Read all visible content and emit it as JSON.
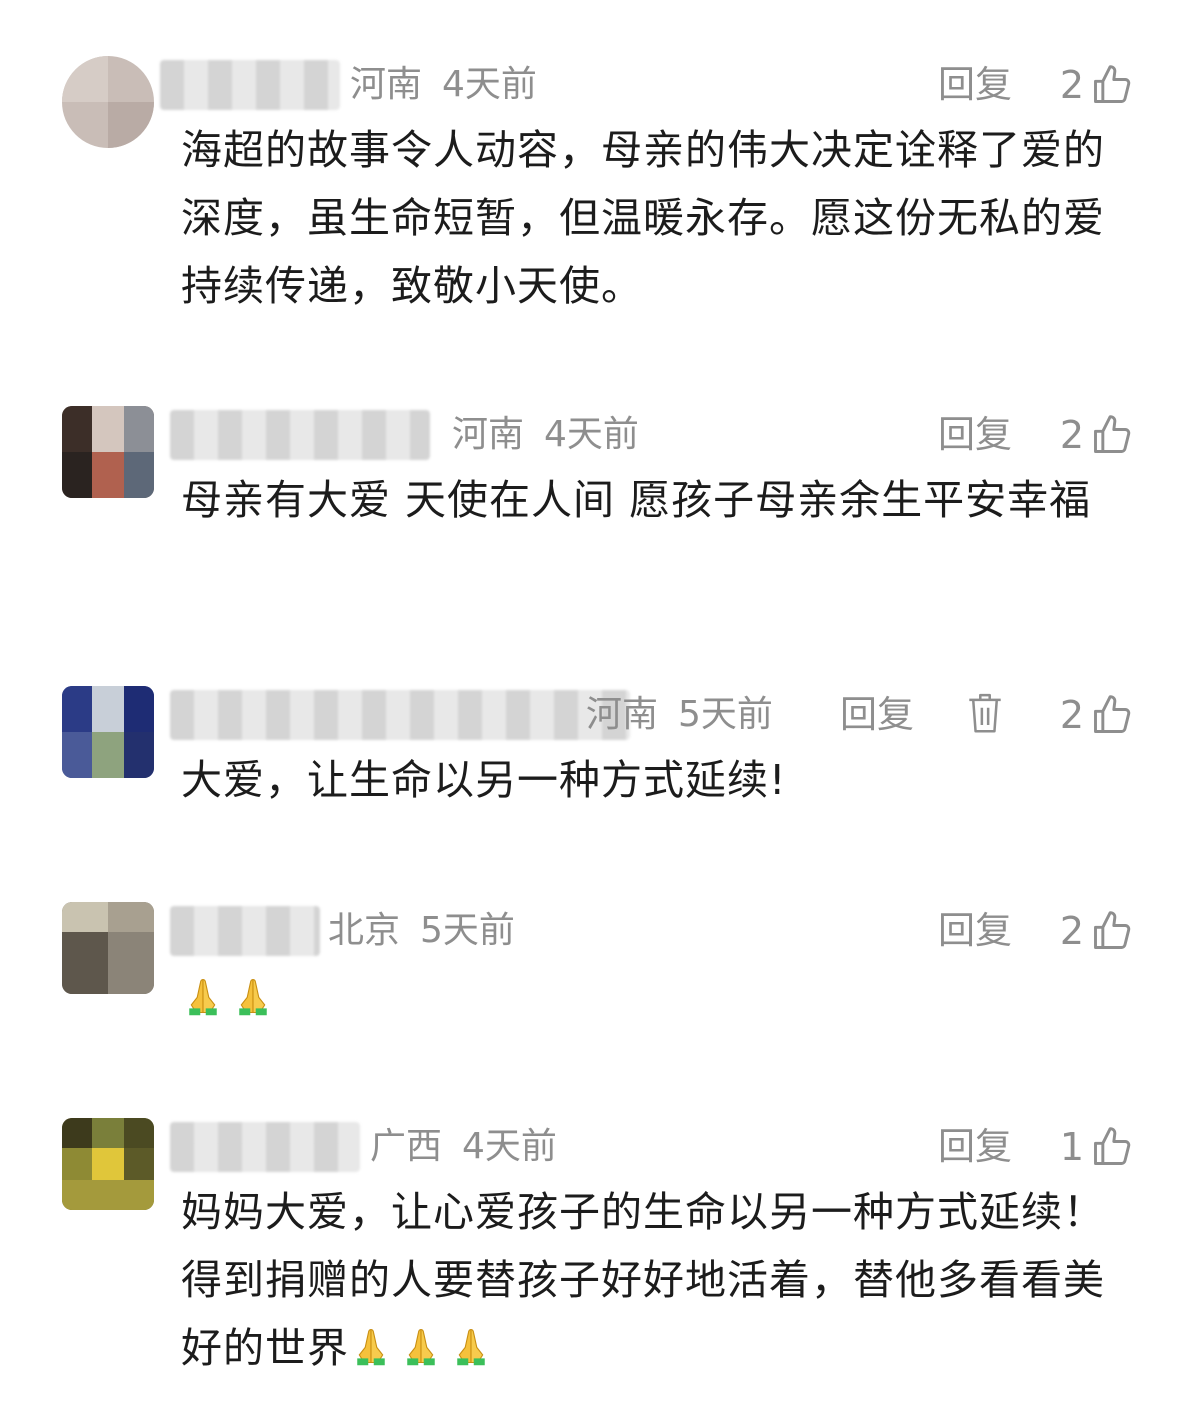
{
  "comments": [
    {
      "location": "河南",
      "time": "4天前",
      "reply_label": "回复",
      "likes": "2",
      "text": "海超的故事令人动容，母亲的伟大决定诠释了爱的深度，虽生命短暂，但温暖永存。愿这份无私的爱持续传递，致敬小天使。",
      "show_delete": false,
      "emoji_count": 0
    },
    {
      "location": "河南",
      "time": "4天前",
      "reply_label": "回复",
      "likes": "2",
      "text": "母亲有大爱 天使在人间 愿孩子母亲余生平安幸福",
      "show_delete": false,
      "emoji_count": 0
    },
    {
      "location": "河南",
      "time": "5天前",
      "reply_label": "回复",
      "likes": "2",
      "text": "大爱，让生命以另一种方式延续!",
      "show_delete": true,
      "emoji_count": 0
    },
    {
      "location": "北京",
      "time": "5天前",
      "reply_label": "回复",
      "likes": "2",
      "text": "",
      "show_delete": false,
      "emoji_count": 2
    },
    {
      "location": "广西",
      "time": "4天前",
      "reply_label": "回复",
      "likes": "1",
      "text": "妈妈大爱，让心爱孩子的生命以另一种方式延续！得到捐赠的人要替孩子好好地活着，替他多看看美好的世界",
      "show_delete": false,
      "emoji_count": 3
    }
  ],
  "icons": {
    "like": "thumbs-up-icon",
    "delete": "trash-icon",
    "emoji": "folded-hands-emoji"
  },
  "colors": {
    "meta_text": "#8e8e8e",
    "body_text": "#1c1c1c"
  }
}
